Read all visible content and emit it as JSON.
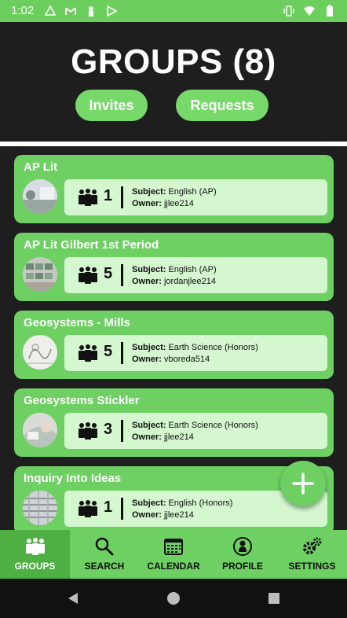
{
  "status_bar": {
    "time": "1:02",
    "icons_left": [
      "sync-icon",
      "gmail-icon",
      "lock-icon",
      "play-icon"
    ],
    "icons_right": [
      "vibrate-icon",
      "wifi-icon",
      "battery-icon"
    ]
  },
  "header": {
    "title": "GROUPS (8)",
    "invites_label": "Invites",
    "requests_label": "Requests"
  },
  "groups": [
    {
      "title": "AP Lit",
      "members": "1",
      "subject_label": "Subject:",
      "subject": "English (AP)",
      "owner_label": "Owner:",
      "owner": "jjlee214"
    },
    {
      "title": "AP Lit Gilbert 1st Period",
      "members": "5",
      "subject_label": "Subject:",
      "subject": "English (AP)",
      "owner_label": "Owner:",
      "owner": "jordanjlee214"
    },
    {
      "title": "Geosystems - Mills",
      "members": "5",
      "subject_label": "Subject:",
      "subject": "Earth Science (Honors)",
      "owner_label": "Owner:",
      "owner": "vboreda514"
    },
    {
      "title": "Geosystems Stickler",
      "members": "3",
      "subject_label": "Subject:",
      "subject": "Earth Science (Honors)",
      "owner_label": "Owner:",
      "owner": "jjlee214"
    },
    {
      "title": "Inquiry Into Ideas",
      "members": "1",
      "subject_label": "Subject:",
      "subject": "English (Honors)",
      "owner_label": "Owner:",
      "owner": "jjlee214"
    }
  ],
  "bottom_nav": {
    "groups": "GROUPS",
    "search": "SEARCH",
    "calendar": "CALENDAR",
    "profile": "PROFILE",
    "settings": "SETTINGS"
  },
  "colors": {
    "accent": "#6ed063",
    "active_tab": "#4eb043",
    "info_box": "#d4f7cf",
    "background": "#1e1e1e"
  }
}
